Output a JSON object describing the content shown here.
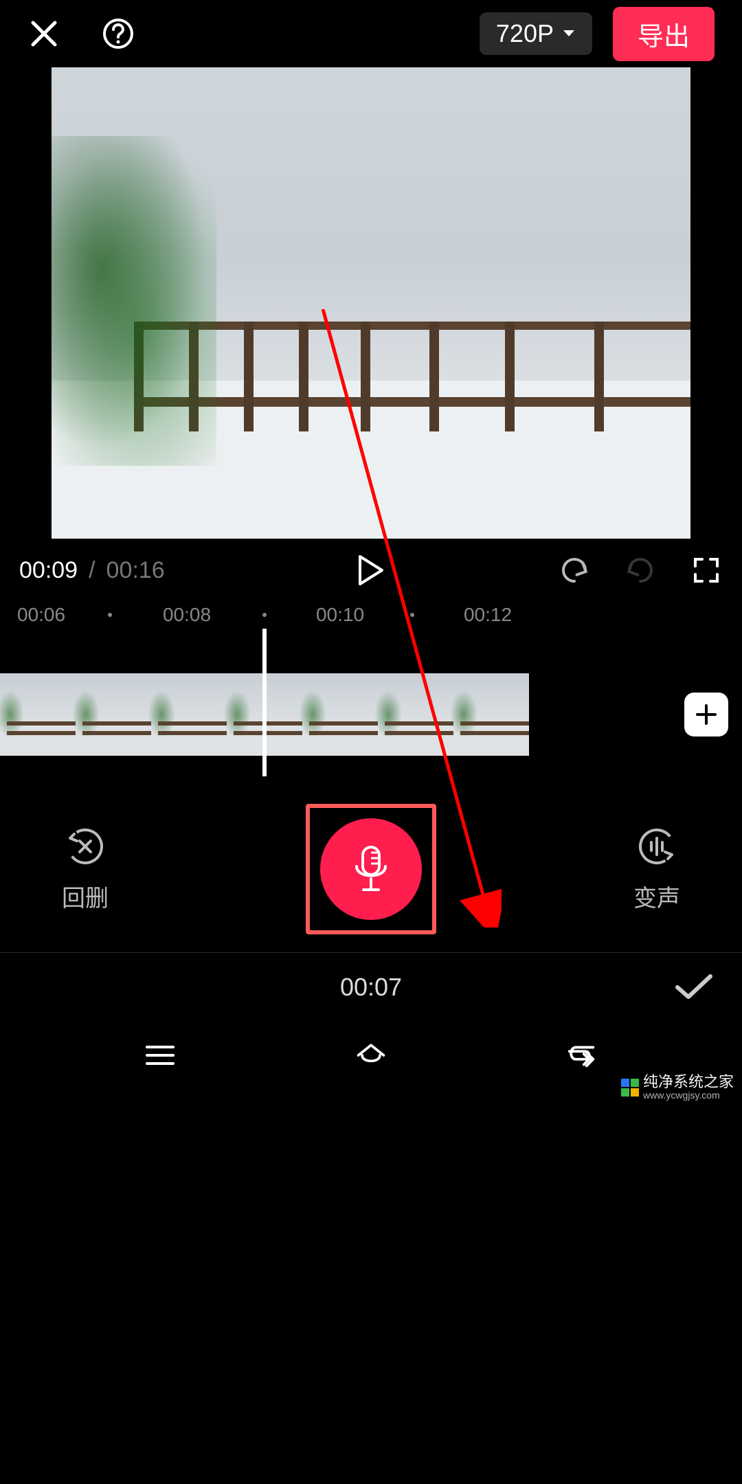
{
  "topbar": {
    "resolution_label": "720P",
    "export_label": "导出"
  },
  "playback": {
    "current_time": "00:09",
    "separator": "/",
    "total_time": "00:16"
  },
  "ruler": {
    "ticks": [
      "00:06",
      "·",
      "00:08",
      "·",
      "00:10",
      "·",
      "00:12"
    ]
  },
  "controls": {
    "undo_label": "回删",
    "voice_change_label": "变声"
  },
  "bottom": {
    "recorded_time": "00:07"
  },
  "watermark": {
    "name": "纯净系统之家",
    "url": "www.ycwgjsy.com"
  },
  "colors": {
    "accent": "#ff2d55",
    "record": "#ff1e4e",
    "highlight_border": "#ff5b5b"
  }
}
